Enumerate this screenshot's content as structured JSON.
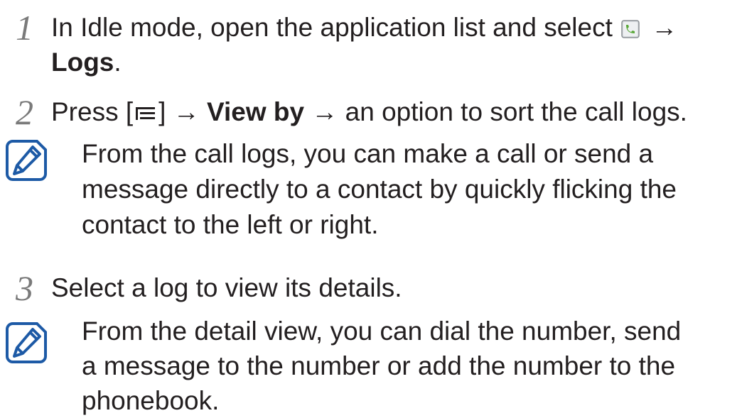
{
  "steps": [
    {
      "number": "1",
      "text_before": "In Idle mode, open the application list and select",
      "icon": "phone-app-icon",
      "arrow": "→",
      "bold_line2": "Logs",
      "after_bold": "."
    },
    {
      "number": "2",
      "press": "Press",
      "bracket_open": "[",
      "icon": "menu-key-icon",
      "bracket_close": "]",
      "arrow1": "→",
      "bold": "View by",
      "arrow2": "→",
      "rest": "an option to sort the call logs."
    },
    {
      "number": "3",
      "text": "Select a log to view its details."
    }
  ],
  "notes": [
    {
      "icon": "note-pencil-icon",
      "lines": [
        "From the call logs, you can make a call or send a",
        "message directly to a contact by quickly flicking the",
        "contact to the left or right."
      ]
    },
    {
      "icon": "note-pencil-icon",
      "lines": [
        "From the detail view, you can dial the number, send",
        "a message to the number or add the number to the",
        "phonebook."
      ]
    }
  ]
}
